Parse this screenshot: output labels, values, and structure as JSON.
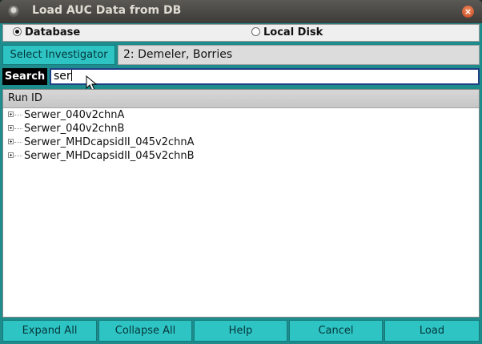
{
  "window": {
    "title": "Load AUC Data from DB",
    "close_glyph": "×"
  },
  "source": {
    "database_label": "Database",
    "local_disk_label": "Local Disk",
    "selected": "database"
  },
  "investigator": {
    "button_label": "Select Investigator",
    "value": "2: Demeler, Borries"
  },
  "search": {
    "label": "Search",
    "value": "ser"
  },
  "tree": {
    "column_header": "Run ID",
    "rows": [
      "Serwer_040v2chnA",
      "Serwer_040v2chnB",
      "Serwer_MHDcapsidII_045v2chnA",
      "Serwer_MHDcapsidII_045v2chnB"
    ]
  },
  "buttons": {
    "expand_all": "Expand All",
    "collapse_all": "Collapse All",
    "help": "Help",
    "cancel": "Cancel",
    "load": "Load"
  },
  "colors": {
    "accent": "#2ec4c4",
    "window_bg": "#1e8c8c",
    "close_button": "#e05a28"
  },
  "icons": [
    "window-menu-icon",
    "close-icon",
    "expand-plus-icon",
    "mouse-cursor-icon"
  ]
}
